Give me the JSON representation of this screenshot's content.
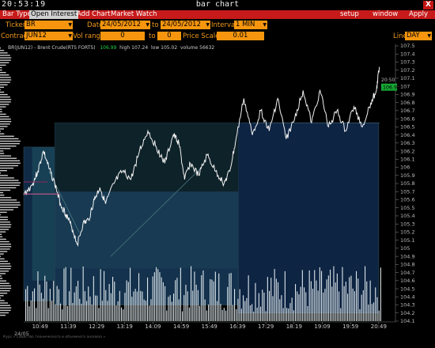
{
  "window": {
    "clock": "20:53:19",
    "title": "bar chart",
    "close": "X"
  },
  "menu": {
    "left": [
      "Bar Type",
      "Open Interest",
      "Add Chart",
      "Market Watch"
    ],
    "right": [
      "setup",
      "window",
      "Apply"
    ]
  },
  "controls": {
    "ticker_label": "Ticker",
    "ticker_value": "BR",
    "date_label": "Date",
    "date_from": "24/05/2012",
    "to_label": "to",
    "date_to": "24/05/2012",
    "interval_label": "Interval",
    "interval_value": "1 MIN",
    "contract_label": "Contract",
    "contract_value": "JUN12",
    "vol_range_label": "Vol range",
    "vol_min": "0",
    "vol_to_label": "to",
    "vol_max": "0",
    "price_scale_label": "Price Scale",
    "price_scale_value": "0.01",
    "line_label": "Line",
    "line_value": "DAY"
  },
  "stats": {
    "symbol": "BR(JUN12) - Brent Crude(RTS FORTS)",
    "last": "106.99",
    "high_label": "high",
    "high": "107.24",
    "low_label": "low",
    "low": "105.02",
    "volume_label": "volume",
    "volume": "56632"
  },
  "footer": "Курс « Свойство технического и объемного анализа »",
  "chart_data": {
    "type": "line",
    "title": "",
    "x_ticks": [
      "10:49",
      "11:39",
      "12:29",
      "13:19",
      "14:09",
      "14:59",
      "15:49",
      "16:39",
      "17:29",
      "18:19",
      "19:09",
      "19:59",
      "20:49"
    ],
    "date_label": "24/05",
    "y_ticks": [
      "107.5",
      "107.4",
      "107.3",
      "107.2",
      "107.1",
      "107",
      "106.9",
      "106.8",
      "106.7",
      "106.6",
      "106.5",
      "106.4",
      "106.3",
      "106.2",
      "106.1",
      "106",
      "105.9",
      "105.8",
      "105.7",
      "105.6",
      "105.5",
      "105.4",
      "105.3",
      "105.2",
      "105.1",
      "105",
      "104.9",
      "104.8",
      "104.7",
      "104.6",
      "104.5",
      "104.4",
      "104.3",
      "104.2",
      "104.1"
    ],
    "ylim": [
      104.1,
      107.5
    ],
    "last_price_label": "106.99",
    "last_time_label": "20:50",
    "price_series": {
      "name": "BR",
      "x": [
        "10:20",
        "10:35",
        "10:45",
        "10:55",
        "11:05",
        "11:15",
        "11:25",
        "11:35",
        "11:45",
        "11:55",
        "12:05",
        "12:15",
        "12:25",
        "12:35",
        "12:45",
        "13:00",
        "13:15",
        "13:30",
        "13:45",
        "14:00",
        "14:15",
        "14:30",
        "14:45",
        "14:55",
        "15:05",
        "15:15",
        "15:30",
        "15:45",
        "16:00",
        "16:15",
        "16:25",
        "16:35",
        "16:50",
        "17:05",
        "17:20",
        "17:35",
        "17:50",
        "18:05",
        "18:20",
        "18:35",
        "18:50",
        "19:05",
        "19:20",
        "19:35",
        "19:50",
        "20:05",
        "20:20",
        "20:35",
        "20:45",
        "20:50"
      ],
      "y": [
        105.66,
        105.78,
        105.95,
        106.2,
        105.98,
        105.8,
        105.55,
        105.42,
        105.26,
        105.05,
        105.3,
        105.35,
        105.6,
        105.75,
        105.55,
        105.8,
        105.95,
        105.85,
        106.2,
        106.45,
        106.25,
        106.05,
        106.4,
        106.3,
        105.85,
        106.05,
        105.9,
        106.15,
        105.95,
        105.8,
        105.95,
        106.3,
        106.85,
        106.4,
        106.7,
        106.45,
        106.85,
        106.35,
        106.6,
        106.95,
        106.55,
        106.95,
        106.5,
        106.7,
        106.45,
        106.75,
        106.5,
        106.8,
        106.95,
        107.24
      ]
    },
    "value_areas": [
      {
        "from": "10:20",
        "to": "11:15",
        "low": 104.35,
        "high": 106.25
      },
      {
        "from": "11:15",
        "to": "16:40",
        "low": 104.3,
        "high": 106.55
      },
      {
        "from": "16:40",
        "to": "20:49",
        "low": 104.2,
        "high": 106.55
      }
    ],
    "grid": false,
    "volume_profile": true,
    "volume_bars": true
  }
}
